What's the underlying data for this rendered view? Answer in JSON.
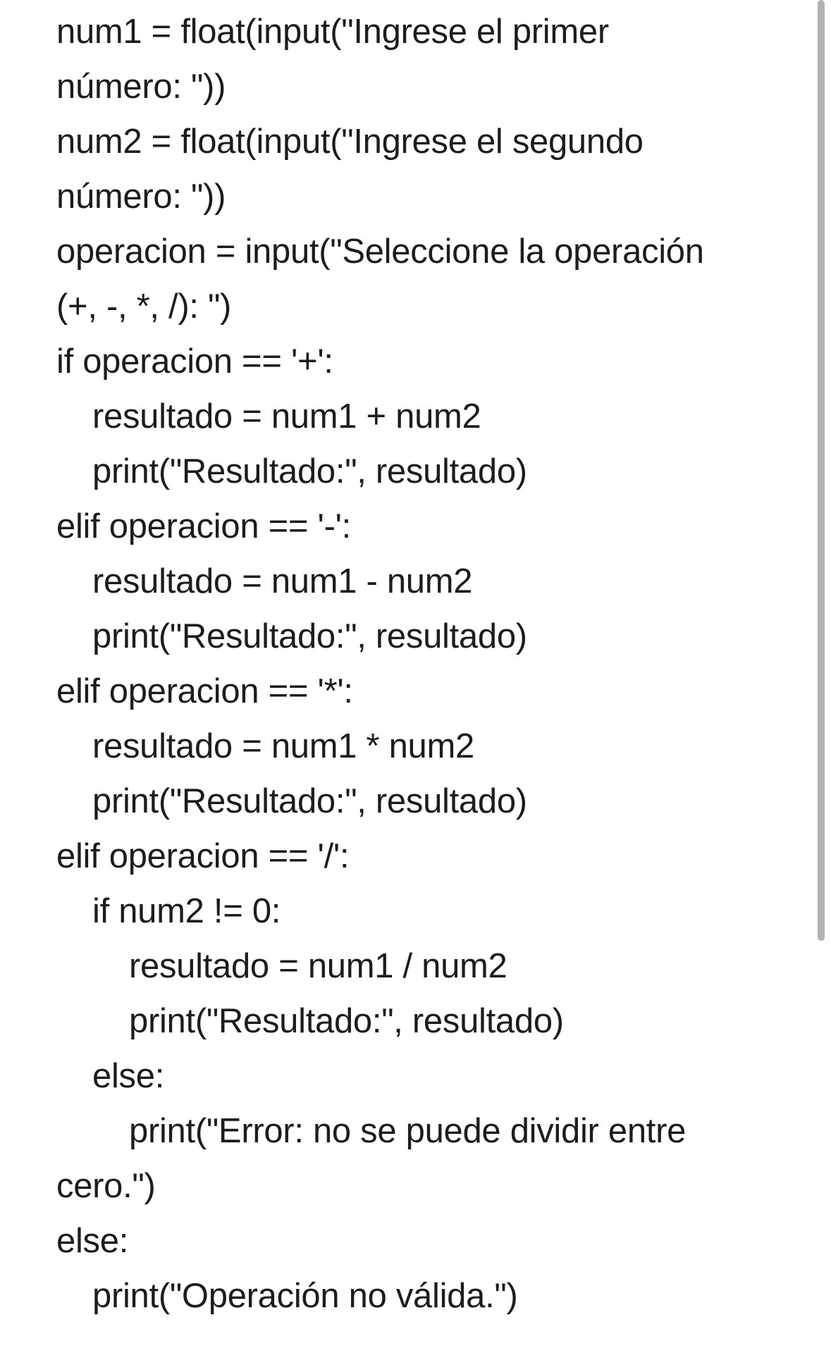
{
  "code": {
    "lines": [
      "num1 = float(input(\"Ingrese el primer",
      "número: \"))",
      "num2 = float(input(\"Ingrese el segundo",
      "número: \"))",
      "operacion = input(\"Seleccione la operación",
      "(+, -, *, /): \")",
      "if operacion == '+':",
      "resultado = num1 + num2",
      "print(\"Resultado:\", resultado)",
      "elif operacion == '-':",
      "resultado = num1 - num2",
      "print(\"Resultado:\", resultado)",
      "elif operacion == '*':",
      "resultado = num1 * num2",
      "print(\"Resultado:\", resultado)",
      "elif operacion == '/':",
      "if num2 != 0:",
      "resultado = num1 / num2",
      "print(\"Resultado:\", resultado)",
      "else:",
      "print(\"Error: no se puede dividir entre",
      "cero.\")",
      "else:",
      "print(\"Operación no válida.\")"
    ]
  }
}
